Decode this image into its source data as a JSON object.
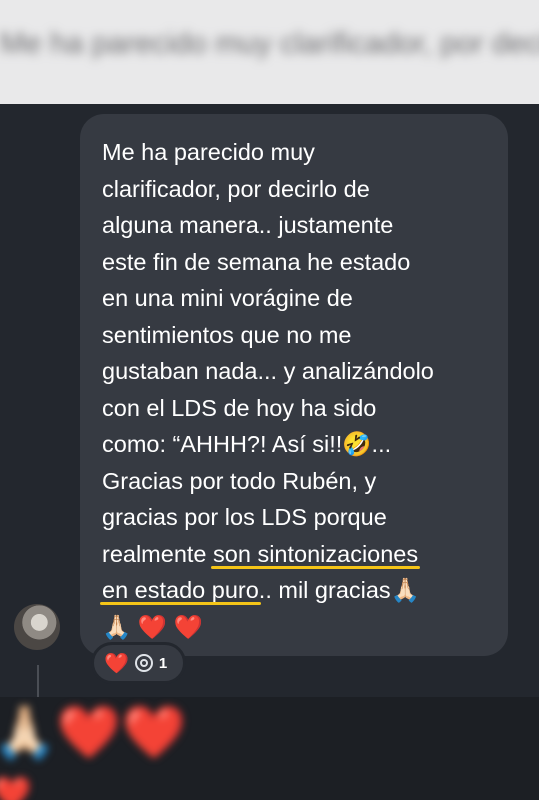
{
  "previous_message": {
    "text": "Me ha parecido muy clarificador, por decirlo de"
  },
  "message": {
    "before": "Me ha parecido muy\nclarificador, por decirlo de\nalguna manera.. justamente\neste fin de semana he estado\nen una mini vorágine de\nsentimientos que no me\ngustaban nada... y analizándolo\ncon el  LDS de hoy ha sido\ncomo: “AHHH?! Así si!!🤣...\nGracias por todo Rubén, y\ngracias por los LDS porque\nrealmente ",
    "underlined_1": "son sintonizaciones",
    "newline": "\n",
    "underlined_2": "en estado puro",
    "after": ".. mil gracias🙏🏻\n🙏🏻 ",
    "heart_1": "❤️",
    "heart_2": "❤️",
    "highlight_color": "#f5c518"
  },
  "reactions": {
    "heart": "❤️",
    "icon": "target-icon",
    "count": "1"
  },
  "next_message": {
    "emoji_row": "🙏🏻❤️❤️",
    "emoji_row_2": "❤️"
  }
}
